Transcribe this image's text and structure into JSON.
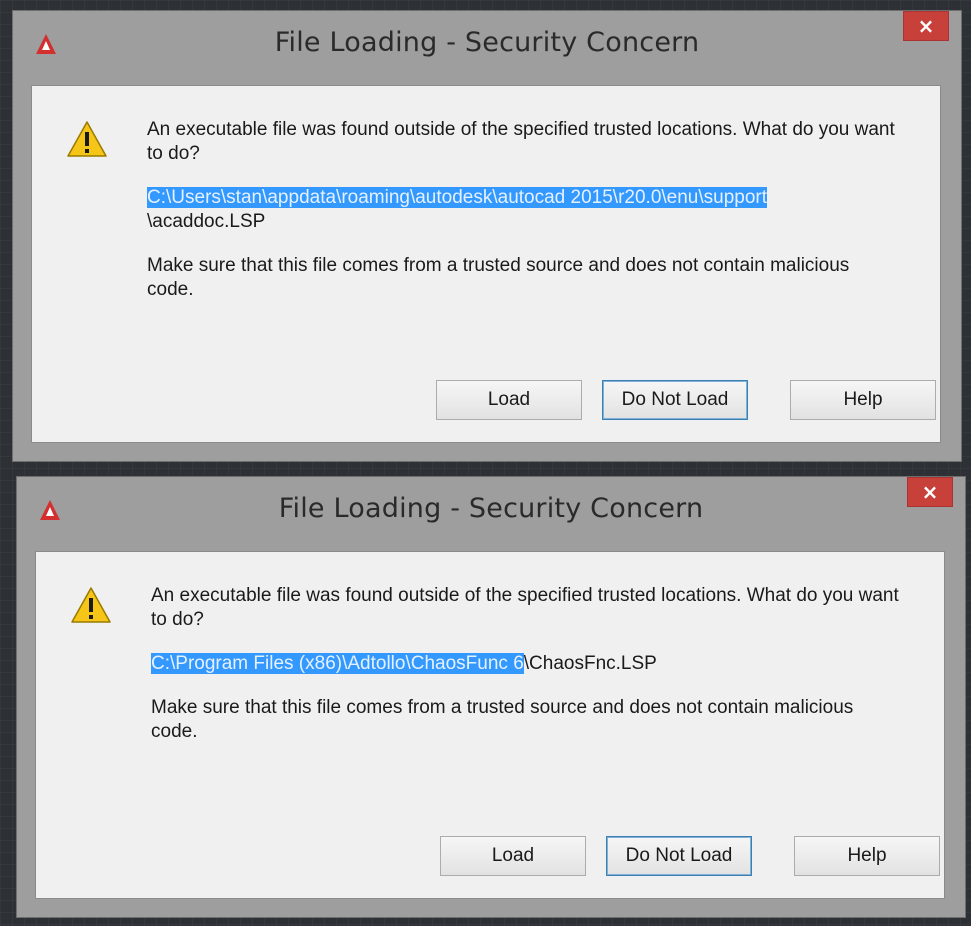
{
  "dialogs": [
    {
      "title": "File Loading - Security Concern",
      "close_label": "×",
      "message": "An executable file was found outside of the specified trusted locations.  What do you want to do?",
      "path_highlighted": "C:\\Users\\stan\\appdata\\roaming\\autodesk\\autocad 2015\\r20.0\\enu\\support",
      "path_rest": "\\acaddoc.LSP",
      "advice": "Make sure that this file comes from a trusted source and does not contain malicious code.",
      "buttons": {
        "load": "Load",
        "do_not_load": "Do Not Load",
        "help": "Help"
      }
    },
    {
      "title": "File Loading - Security Concern",
      "close_label": "×",
      "message": "An executable file was found outside of the specified trusted locations.  What do you want to do?",
      "path_highlighted": "C:\\Program Files (x86)\\Adtollo\\ChaosFunc 6",
      "path_rest": "\\ChaosFnc.LSP",
      "advice": "Make sure that this file comes from a trusted source and does not contain malicious code.",
      "buttons": {
        "load": "Load",
        "do_not_load": "Do Not Load",
        "help": "Help"
      }
    }
  ],
  "colors": {
    "selection": "#3399ff",
    "close_button": "#c7403a",
    "dialog_frame": "#9e9e9e",
    "app_icon": "#d32f2f",
    "warning_icon": "#f5c518"
  },
  "icons": {
    "app": "autocad-logo-icon",
    "warning": "warning-icon",
    "close": "close-icon"
  }
}
